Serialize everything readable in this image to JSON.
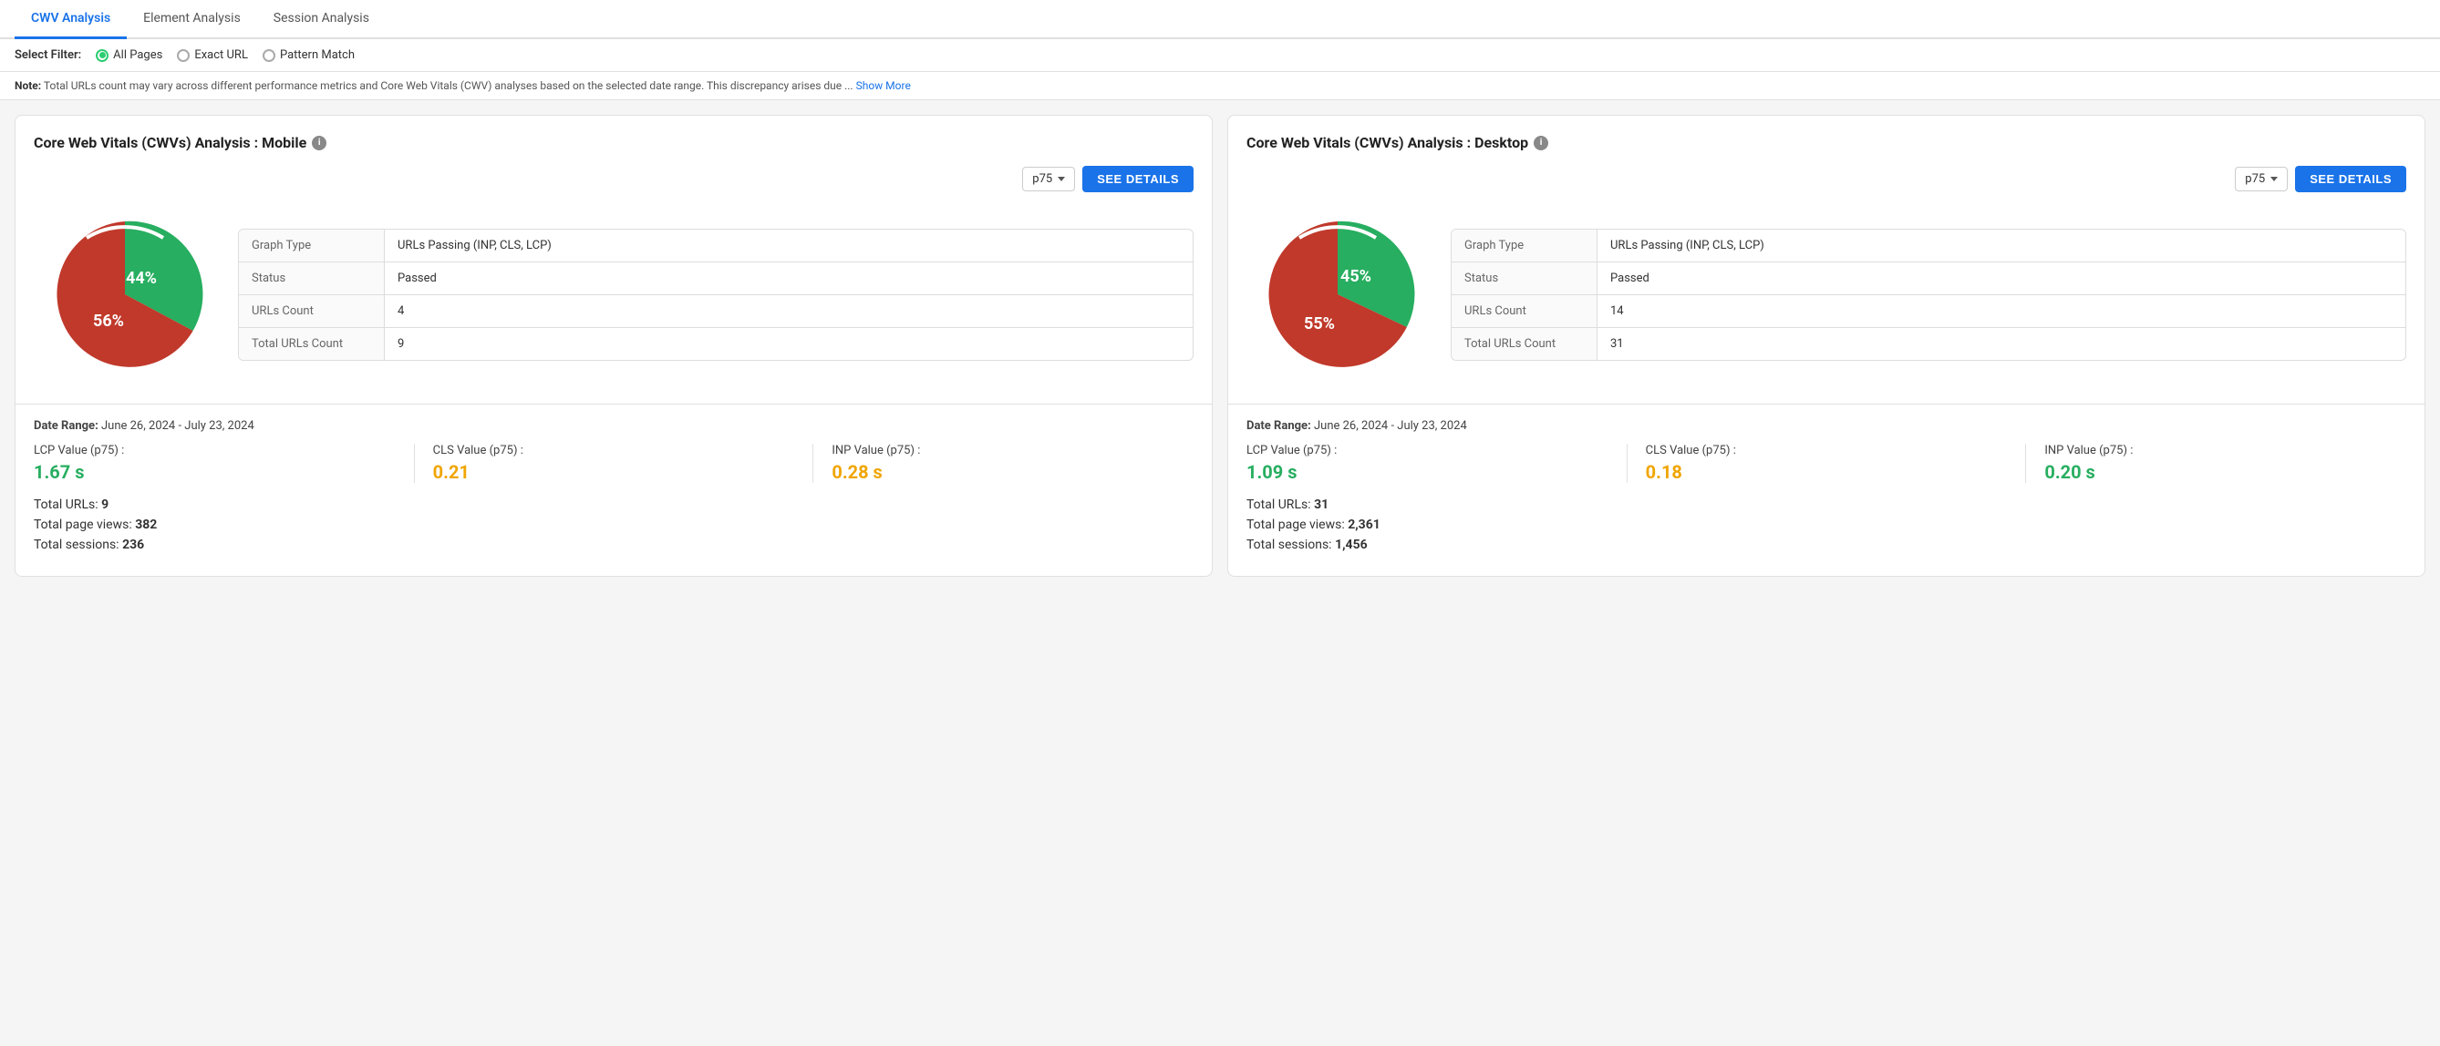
{
  "tabs": [
    {
      "id": "cwv",
      "label": "CWV Analysis",
      "active": true
    },
    {
      "id": "element",
      "label": "Element Analysis",
      "active": false
    },
    {
      "id": "session",
      "label": "Session Analysis",
      "active": false
    }
  ],
  "filter": {
    "label": "Select Filter:",
    "options": [
      {
        "id": "all-pages",
        "label": "All Pages",
        "selected": true
      },
      {
        "id": "exact-url",
        "label": "Exact URL",
        "selected": false
      },
      {
        "id": "pattern-match",
        "label": "Pattern Match",
        "selected": false
      }
    ]
  },
  "note": {
    "prefix": "Note:",
    "text": " Total URLs count may vary across different performance metrics and Core Web Vitals (CWV) analyses based on the selected date range. This discrepancy arises due ...",
    "show_more": "Show More"
  },
  "mobile_card": {
    "title": "Core Web Vitals (CWVs) Analysis : Mobile",
    "dropdown_value": "p75",
    "see_details_label": "SEE DETAILS",
    "pie": {
      "green_pct": 44,
      "red_pct": 56,
      "green_label": "44%",
      "red_label": "56%"
    },
    "stats": [
      {
        "key": "Graph Type",
        "value": "URLs Passing (INP, CLS, LCP)"
      },
      {
        "key": "Status",
        "value": "Passed"
      },
      {
        "key": "URLs Count",
        "value": "4"
      },
      {
        "key": "Total URLs Count",
        "value": "9"
      }
    ],
    "date_range_label": "Date Range:",
    "date_range_value": "June 26, 2024 - July 23, 2024",
    "lcp_label": "LCP Value (p75) :",
    "lcp_value": "1.67 s",
    "lcp_color": "green",
    "cls_label": "CLS Value (p75) :",
    "cls_value": "0.21",
    "cls_color": "yellow",
    "inp_label": "INP Value (p75) :",
    "inp_value": "0.28 s",
    "inp_color": "yellow",
    "total_urls_label": "Total URLs:",
    "total_urls_value": "9",
    "page_views_label": "Total page views:",
    "page_views_value": "382",
    "sessions_label": "Total sessions:",
    "sessions_value": "236"
  },
  "desktop_card": {
    "title": "Core Web Vitals (CWVs) Analysis : Desktop",
    "dropdown_value": "p75",
    "see_details_label": "SEE DETAILS",
    "pie": {
      "green_pct": 45,
      "red_pct": 55,
      "green_label": "45%",
      "red_label": "55%"
    },
    "stats": [
      {
        "key": "Graph Type",
        "value": "URLs Passing (INP, CLS, LCP)"
      },
      {
        "key": "Status",
        "value": "Passed"
      },
      {
        "key": "URLs Count",
        "value": "14"
      },
      {
        "key": "Total URLs Count",
        "value": "31"
      }
    ],
    "date_range_label": "Date Range:",
    "date_range_value": "June 26, 2024 - July 23, 2024",
    "lcp_label": "LCP Value (p75) :",
    "lcp_value": "1.09 s",
    "lcp_color": "green",
    "cls_label": "CLS Value (p75) :",
    "cls_value": "0.18",
    "cls_color": "yellow",
    "inp_label": "INP Value (p75) :",
    "inp_value": "0.20 s",
    "inp_color": "green",
    "total_urls_label": "Total URLs:",
    "total_urls_value": "31",
    "page_views_label": "Total page views:",
    "page_views_value": "2,361",
    "sessions_label": "Total sessions:",
    "sessions_value": "1,456"
  }
}
